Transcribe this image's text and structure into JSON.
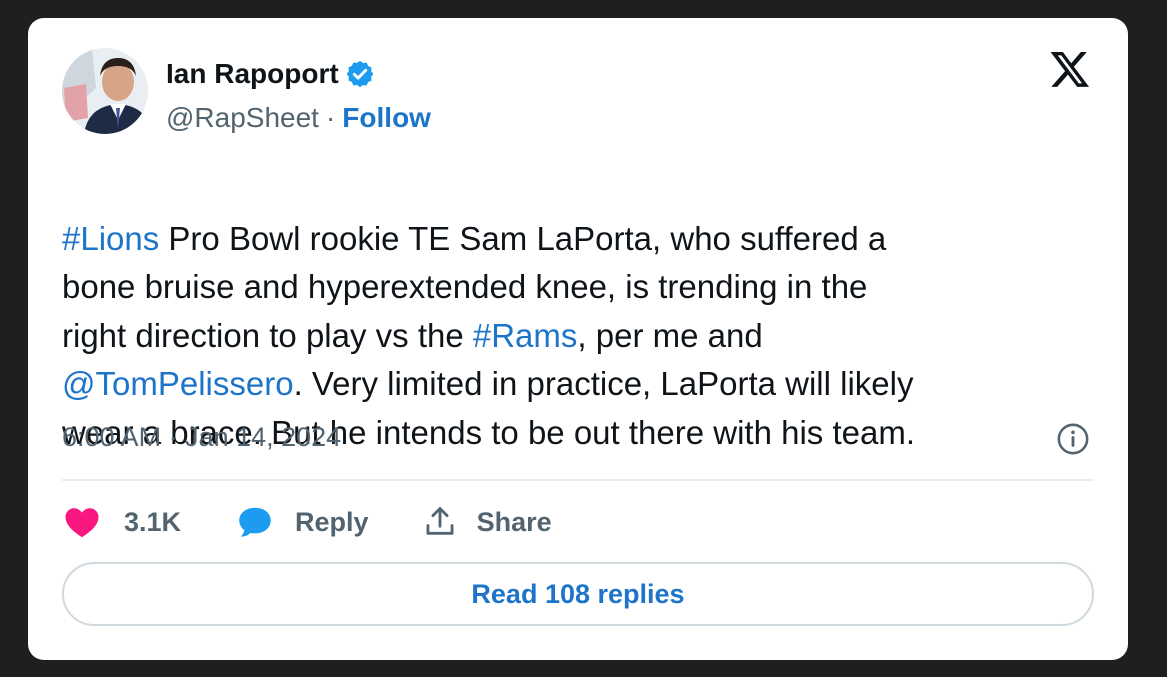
{
  "author": {
    "name": "Ian Rapoport",
    "handle": "@RapSheet",
    "separator": "·",
    "follow_label": "Follow",
    "verified": true
  },
  "tweet": {
    "segments": [
      {
        "text": "#Lions",
        "link": true
      },
      {
        "text": " Pro Bowl rookie TE Sam LaPorta, who suffered a\nbone bruise and hyperextended knee, is trending in the\nright direction to play vs the ",
        "link": false
      },
      {
        "text": "#Rams",
        "link": true
      },
      {
        "text": ", per me and\n",
        "link": false
      },
      {
        "text": "@TomPelissero",
        "link": true
      },
      {
        "text": ". Very limited in practice, LaPorta will likely\nwear a brace. But he intends to be out there with his team.",
        "link": false
      }
    ],
    "timestamp": "6:00 AM · Jan 14, 2024"
  },
  "actions": {
    "like_count": "3.1K",
    "reply_label": "Reply",
    "share_label": "Share",
    "read_replies_label": "Read 108 replies"
  },
  "icons": {
    "logo": "x-logo-icon",
    "verified": "verified-badge-icon",
    "info": "info-icon",
    "like": "heart-icon",
    "reply": "speech-bubble-icon",
    "share": "share-icon"
  },
  "colors": {
    "link": "#1d74c9",
    "heart": "#f91880",
    "verified": "#1d9bf0",
    "reply_icon": "#1d9bf0",
    "muted": "#536471"
  }
}
